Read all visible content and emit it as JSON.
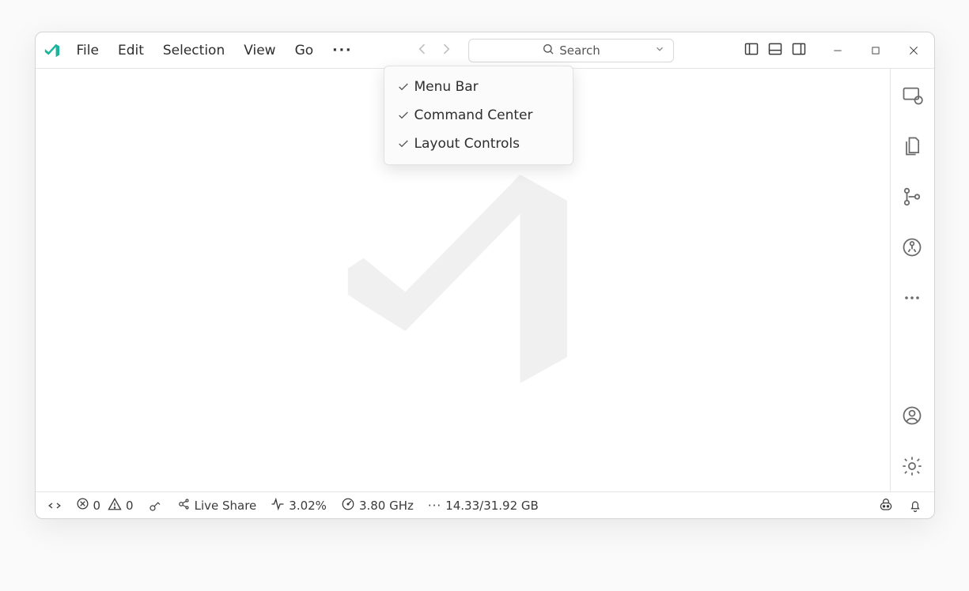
{
  "menu": {
    "items": [
      "File",
      "Edit",
      "Selection",
      "View",
      "Go"
    ],
    "overflow": "···"
  },
  "search": {
    "placeholder": "Search"
  },
  "context_menu": {
    "items": [
      {
        "label": "Menu Bar",
        "checked": true
      },
      {
        "label": "Command Center",
        "checked": true
      },
      {
        "label": "Layout Controls",
        "checked": true
      }
    ]
  },
  "statusbar": {
    "errors": "0",
    "warnings": "0",
    "live_share": "Live Share",
    "cpu": "3.02%",
    "freq": "3.80 GHz",
    "mem": "14.33/31.92 GB"
  },
  "icons": {
    "remote": "remote-explorer-icon",
    "explorer": "files-icon",
    "source_control": "source-control-icon",
    "live_share_circle": "live-share-circle-icon",
    "more": "more-icon",
    "account": "account-icon",
    "settings": "gear-icon",
    "copilot": "copilot-icon",
    "bell": "bell-icon"
  }
}
